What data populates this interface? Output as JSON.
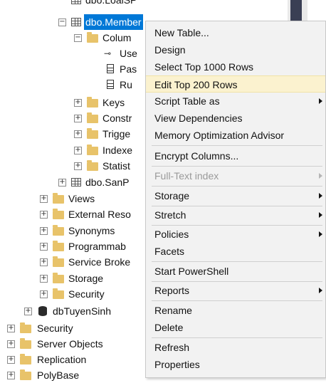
{
  "tree": {
    "top_partial": "dbo.LoaiSP",
    "table_member": "dbo.Member",
    "columns": "Colum",
    "col_use": "Use",
    "col_pas": "Pas",
    "col_ru": "Ru",
    "keys": "Keys",
    "constraints": "Constr",
    "triggers": "Trigge",
    "indexes": "Indexe",
    "statistics": "Statist",
    "table_sanpham": "dbo.SanP",
    "views": "Views",
    "external_resources": "External Reso",
    "synonyms": "Synonyms",
    "programmability": "Programmab",
    "service_broker": "Service Broke",
    "storage": "Storage",
    "security_db": "Security",
    "db_tuyensinh": "dbTuyenSinh",
    "security_server": "Security",
    "server_objects": "Server Objects",
    "replication": "Replication",
    "polybase": "PolyBase",
    "expand_glyph": "+",
    "collapse_glyph": "−",
    "key_glyph": "⊸"
  },
  "context_menu": {
    "new_table": "New Table...",
    "design": "Design",
    "select_top": "Select Top 1000 Rows",
    "edit_top": "Edit Top 200 Rows",
    "script_table_as": "Script Table as",
    "view_dependencies": "View Dependencies",
    "memory_optimization": "Memory Optimization Advisor",
    "encrypt_columns": "Encrypt Columns...",
    "full_text_index": "Full-Text index",
    "storage": "Storage",
    "stretch": "Stretch",
    "policies": "Policies",
    "facets": "Facets",
    "start_powershell": "Start PowerShell",
    "reports": "Reports",
    "rename": "Rename",
    "delete": "Delete",
    "refresh": "Refresh",
    "properties": "Properties"
  },
  "colors": {
    "selection": "#0078d7",
    "menu_background": "#f2f2f2",
    "menu_highlight": "#fbf2cf",
    "folder": "#e8c36a"
  }
}
